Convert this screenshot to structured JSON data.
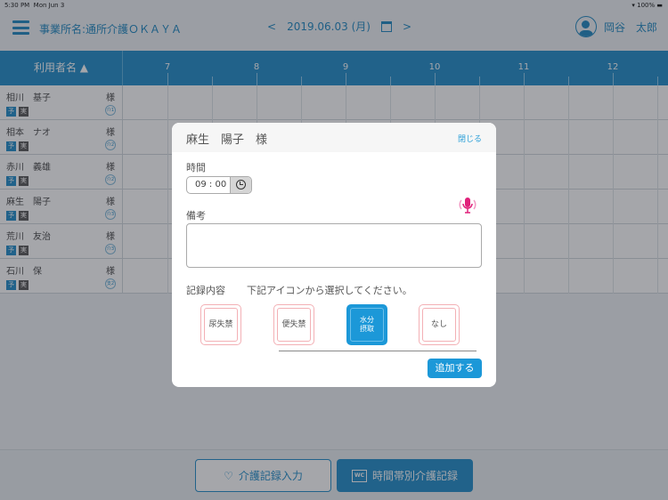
{
  "status": {
    "time": "5:30 PM",
    "date": "Mon Jun 3",
    "battery": "100%"
  },
  "header": {
    "office": "事業所名:通所介護ＯＫＡＹＡ",
    "date": "2019.06.03 (月)",
    "prev": "<",
    "next": ">",
    "user": "岡谷　太郎"
  },
  "table": {
    "name_header": "利用者名 ▲",
    "hours": [
      "7",
      "8",
      "9",
      "10",
      "11",
      "12"
    ],
    "rows": [
      {
        "name": "相川　基子",
        "suffix": "様",
        "plan": "予",
        "actual": "実",
        "level": "介1"
      },
      {
        "name": "相本　ナオ",
        "suffix": "様",
        "plan": "予",
        "actual": "実",
        "level": "介2"
      },
      {
        "name": "赤川　義雄",
        "suffix": "様",
        "plan": "予",
        "actual": "実",
        "level": "介2"
      },
      {
        "name": "麻生　陽子",
        "suffix": "様",
        "plan": "予",
        "actual": "実",
        "level": "介3"
      },
      {
        "name": "荒川　友治",
        "suffix": "様",
        "plan": "予",
        "actual": "実",
        "level": "介3"
      },
      {
        "name": "石川　保",
        "suffix": "様",
        "plan": "予",
        "actual": "実",
        "level": "支2"
      }
    ]
  },
  "bottom": {
    "care_input": "介護記録入力",
    "hourly_record": "時間帯別介護記録",
    "wc": "WC"
  },
  "modal": {
    "title": "麻生　陽子　様",
    "close": "閉じる",
    "time_label": "時間",
    "time_value": "09 : 00",
    "notes_label": "備考",
    "notes_value": "",
    "record_label": "記録内容",
    "record_hint": "下記アイコンから選択してください。",
    "options": [
      {
        "label": "尿失禁",
        "selected": false
      },
      {
        "label": "便失禁",
        "selected": false
      },
      {
        "label": "水分\n摂取",
        "selected": true
      },
      {
        "label": "なし",
        "selected": false
      }
    ],
    "add": "追加する"
  },
  "colors": {
    "primary": "#1c8bc8",
    "mic": "#e0207a"
  }
}
